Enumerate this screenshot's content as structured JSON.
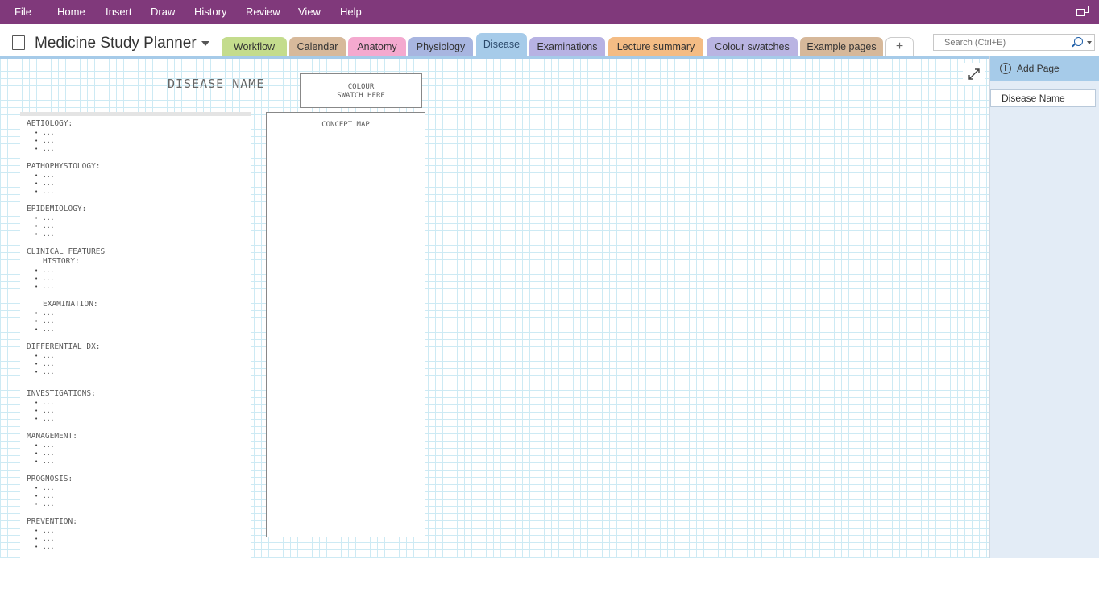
{
  "menu": [
    "File",
    "Home",
    "Insert",
    "Draw",
    "History",
    "Review",
    "View",
    "Help"
  ],
  "notebook": {
    "title": "Medicine Study Planner"
  },
  "tabs": [
    {
      "label": "Workflow",
      "color": "#c4dc8d"
    },
    {
      "label": "Calendar",
      "color": "#d7b99b"
    },
    {
      "label": "Anatomy",
      "color": "#f4a9cf"
    },
    {
      "label": "Physiology",
      "color": "#a8b5e0"
    },
    {
      "label": "Disease",
      "color": "#a6cbe9",
      "active": true
    },
    {
      "label": "Examinations",
      "color": "#b7b2e3"
    },
    {
      "label": "Lecture summary",
      "color": "#f4bc84"
    },
    {
      "label": "Colour swatches",
      "color": "#b9b4e2"
    },
    {
      "label": "Example pages",
      "color": "#d6b89a"
    },
    {
      "label": "+"
    }
  ],
  "search": {
    "placeholder": "Search (Ctrl+E)"
  },
  "page": {
    "title": "DISEASE NAME",
    "swatch_line1": "COLOUR",
    "swatch_line2": "SWATCH HERE",
    "concept_map": "CONCEPT MAP",
    "sections": [
      {
        "heading": "AETIOLOGY:",
        "bullets": [
          "...",
          "...",
          "..."
        ]
      },
      {
        "heading": "PATHOPHYSIOLOGY:",
        "bullets": [
          "...",
          "...",
          "..."
        ]
      },
      {
        "heading": "EPIDEMIOLOGY:",
        "bullets": [
          "...",
          "...",
          "..."
        ]
      },
      {
        "heading": "CLINICAL FEATURES",
        "subheading": "HISTORY:",
        "bullets": [
          "...",
          "...",
          "..."
        ]
      },
      {
        "subheading": "EXAMINATION:",
        "bullets": [
          "...",
          "...",
          "..."
        ]
      },
      {
        "heading": "DIFFERENTIAL DX:",
        "bullets": [
          "...",
          "...",
          "..."
        ]
      },
      {
        "heading": "INVESTIGATIONS:",
        "bullets": [
          "...",
          "...",
          "..."
        ]
      },
      {
        "heading": "MANAGEMENT:",
        "bullets": [
          "...",
          "...",
          "..."
        ]
      },
      {
        "heading": "PROGNOSIS:",
        "bullets": [
          "...",
          "...",
          "..."
        ]
      },
      {
        "heading": "PREVENTION:",
        "bullets": [
          "...",
          "...",
          "..."
        ]
      }
    ]
  },
  "sidebar": {
    "add_page": "Add Page",
    "pages": [
      "Disease Name"
    ]
  }
}
